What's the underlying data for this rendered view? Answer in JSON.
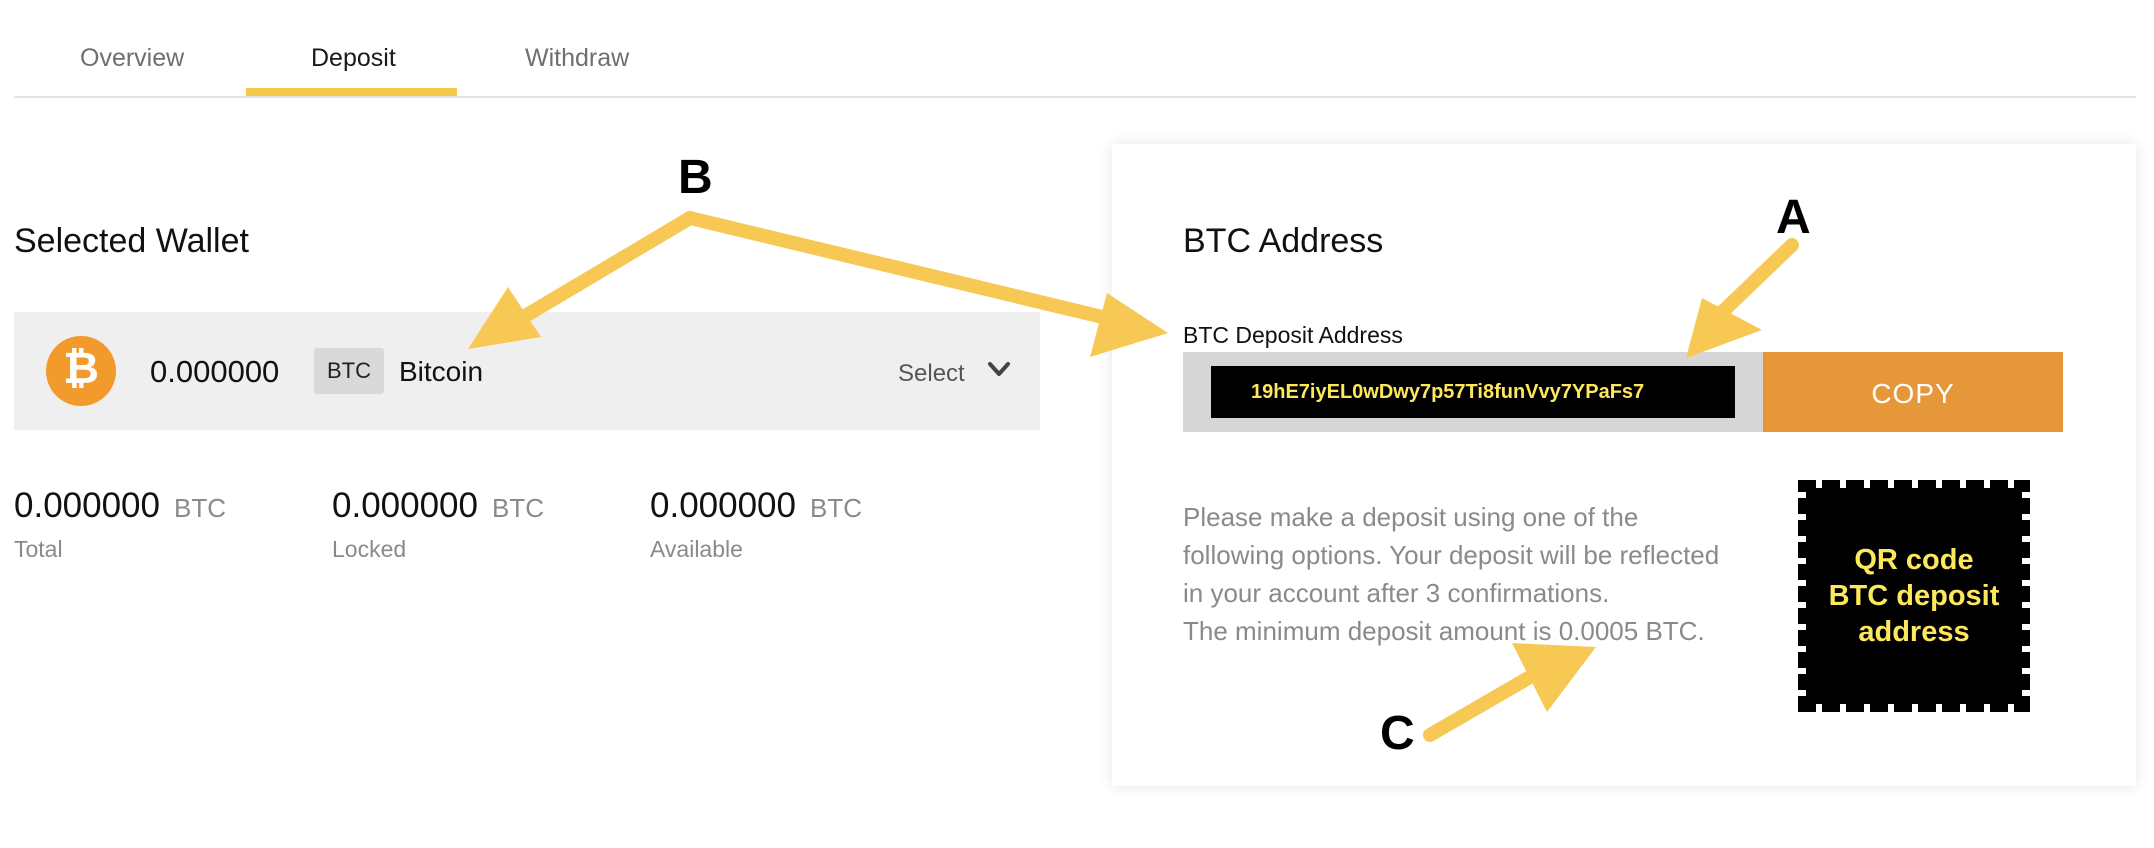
{
  "tabs": [
    {
      "label": "Overview",
      "active": false
    },
    {
      "label": "Deposit",
      "active": true
    },
    {
      "label": "Withdraw",
      "active": false
    }
  ],
  "wallet": {
    "section_title": "Selected Wallet",
    "icon": "bitcoin-icon",
    "icon_glyph": "₿",
    "amount": "0.000000",
    "ticker": "BTC",
    "name": "Bitcoin",
    "select_label": "Select"
  },
  "balances": [
    {
      "value": "0.000000",
      "unit": "BTC",
      "label": "Total"
    },
    {
      "value": "0.000000",
      "unit": "BTC",
      "label": "Locked"
    },
    {
      "value": "0.000000",
      "unit": "BTC",
      "label": "Available"
    }
  ],
  "deposit": {
    "card_title": "BTC Address",
    "address_label": "BTC Deposit Address",
    "address": "19hE7iyEL0wDwy7p57Ti8funVvy7YPaFs7",
    "copy_label": "COPY",
    "note_lines": [
      "Please make a deposit using one of the",
      "following options. Your deposit will be reflected",
      "in your account after 3 confirmations.",
      "The minimum deposit amount is 0.0005 BTC."
    ],
    "qr_lines": [
      "QR code",
      "BTC deposit",
      "address"
    ]
  },
  "annotations": {
    "markers": [
      "A",
      "B",
      "C"
    ],
    "arrow_color": "#f7c954"
  },
  "colors": {
    "accent_tab": "#f5c94a",
    "bitcoin_orange": "#f39a2d",
    "copy_button": "#e6973a",
    "address_text": "#fde85b"
  }
}
